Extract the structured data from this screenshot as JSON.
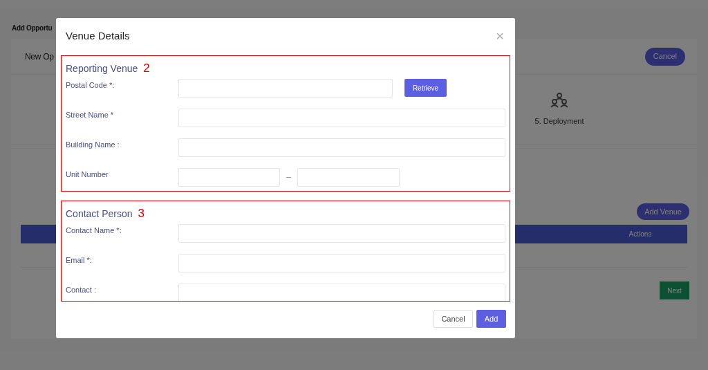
{
  "page": {
    "title": "Add Opportu",
    "card_title": "New Op",
    "cancel_button": "Cancel",
    "steps": [
      {
        "label": "5. Deployment"
      }
    ],
    "add_venue_button": "Add Venue",
    "table": {
      "columns": [
        "Actions"
      ]
    },
    "next_button": "Next"
  },
  "modal": {
    "title": "Venue Details",
    "close": "×",
    "sections": [
      {
        "title": "Reporting Venue",
        "annotation": "2",
        "cut": false,
        "fields": [
          {
            "kind": "lookup",
            "label": "Postal Code *:",
            "button": "Retrieve"
          },
          {
            "kind": "text",
            "label": "Street Name *"
          },
          {
            "kind": "text",
            "label": "Building Name :"
          },
          {
            "kind": "split",
            "label": "Unit Number",
            "separator": "–"
          }
        ]
      },
      {
        "title": "Contact Person",
        "annotation": "3",
        "cut": true,
        "fields": [
          {
            "kind": "text",
            "label": "Contact Name *:"
          },
          {
            "kind": "text",
            "label": "Email *:"
          },
          {
            "kind": "text",
            "label": "Contact :"
          }
        ]
      }
    ],
    "buttons": [
      {
        "label": "Cancel",
        "primary": false
      },
      {
        "label": "Add",
        "primary": true
      }
    ]
  }
}
